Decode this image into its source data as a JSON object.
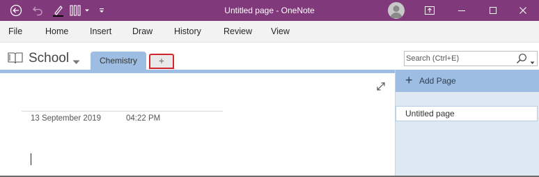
{
  "window": {
    "title": "Untitled page  -  OneNote",
    "accent_color": "#80397b"
  },
  "title_bar": {
    "quick_access": [
      "back-icon",
      "undo-icon",
      "pen-icon",
      "ruled-lines-icon",
      "dropdown-icon",
      "customize-toolbar-icon"
    ],
    "right_controls": [
      "account-avatar-icon",
      "full-screen-icon",
      "minimize-icon",
      "maximize-icon",
      "close-icon"
    ]
  },
  "menu": {
    "items": [
      "File",
      "Home",
      "Insert",
      "Draw",
      "History",
      "Review",
      "View"
    ]
  },
  "notebook": {
    "name": "School",
    "sections": [
      {
        "label": "Chemistry",
        "color": "#9dbde2"
      }
    ],
    "add_section_label": "+"
  },
  "search": {
    "placeholder": "Search (Ctrl+E)"
  },
  "page": {
    "date": "13 September 2019",
    "time": "04:22 PM"
  },
  "page_panel": {
    "add_page_label": "Add Page",
    "pages": [
      "Untitled page"
    ]
  }
}
